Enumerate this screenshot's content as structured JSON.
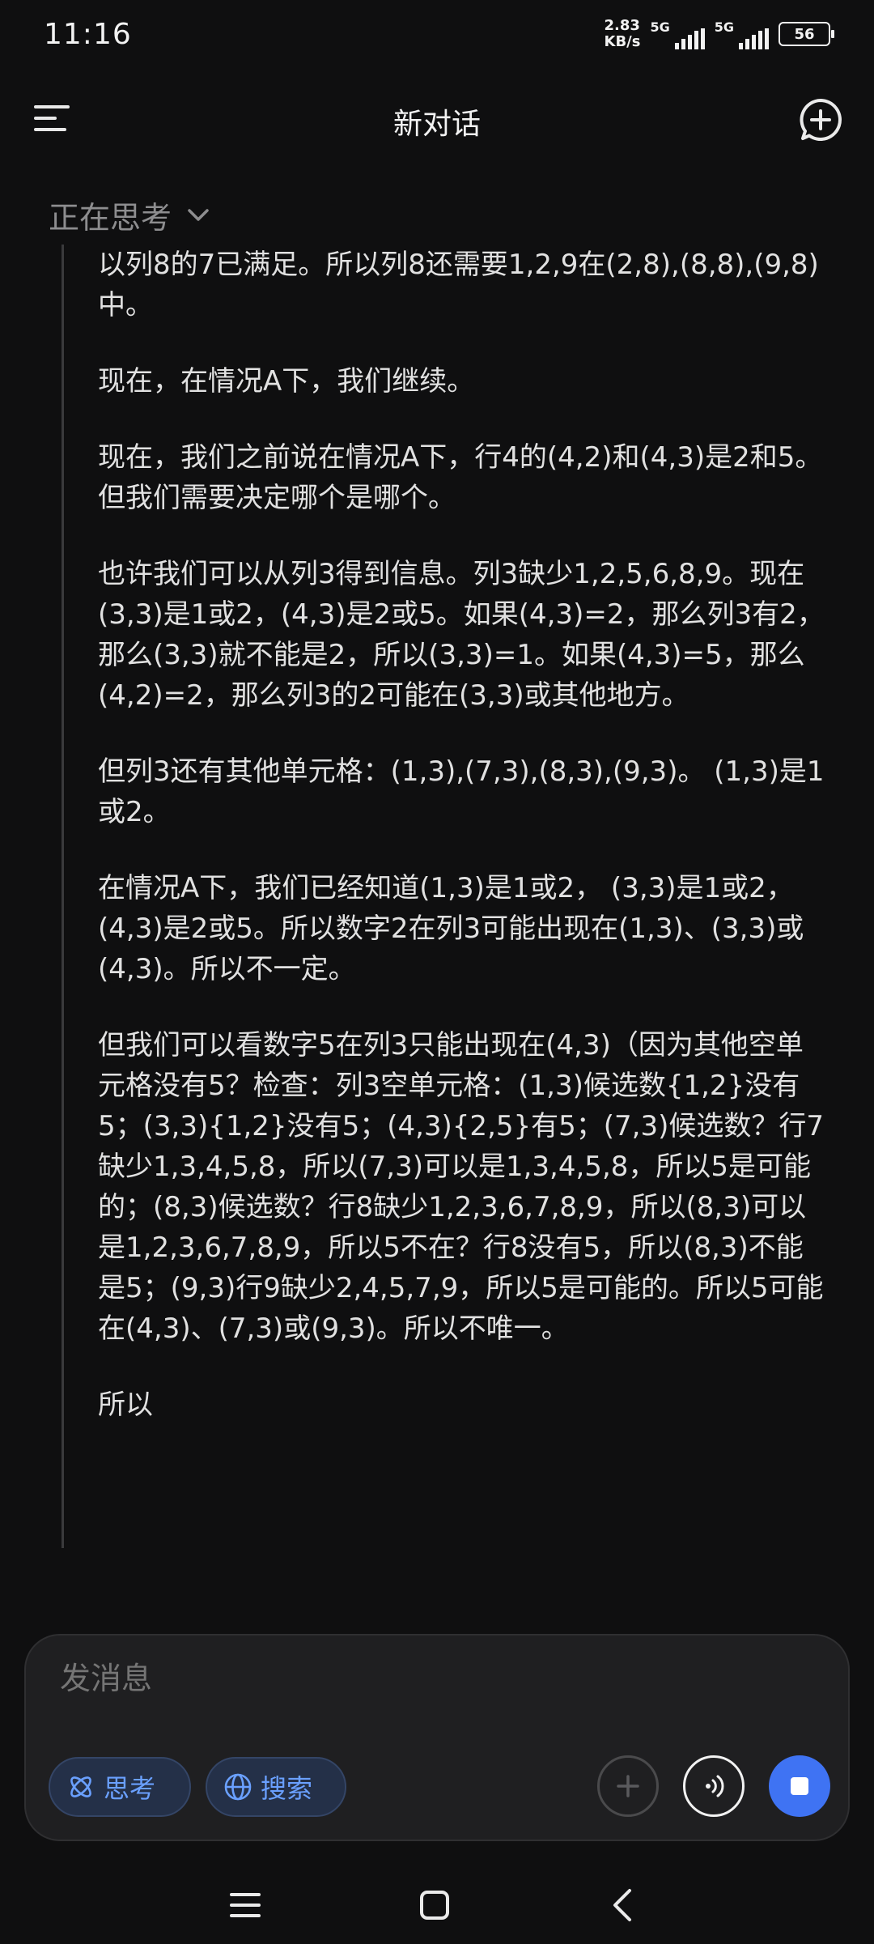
{
  "status_bar": {
    "time": "11:16",
    "speed_value": "2.83",
    "speed_unit": "KB/s",
    "network_1": "5G",
    "network_2": "5G",
    "battery": "56"
  },
  "header": {
    "title": "新对话"
  },
  "thinking": {
    "label": "正在思考",
    "paragraphs": [
      "以列8的7已满足。所以列8还需要1,2,9在(2,8),(8,8),(9,8)中。",
      "现在，在情况A下，我们继续。",
      "现在，我们之前说在情况A下，行4的(4,2)和(4,3)是2和5。但我们需要决定哪个是哪个。",
      "也许我们可以从列3得到信息。列3缺少1,2,5,6,8,9。现在(3,3)是1或2，(4,3)是2或5。如果(4,3)=2，那么列3有2，那么(3,3)就不能是2，所以(3,3)=1。如果(4,3)=5，那么(4,2)=2，那么列3的2可能在(3,3)或其他地方。",
      "但列3还有其他单元格：(1,3),(7,3),(8,3),(9,3)。 (1,3)是1或2。",
      "在情况A下，我们已经知道(1,3)是1或2， (3,3)是1或2，(4,3)是2或5。所以数字2在列3可能出现在(1,3)、(3,3)或(4,3)。所以不一定。",
      "但我们可以看数字5在列3只能出现在(4,3)（因为其他空单元格没有5？检查：列3空单元格：(1,3)候选数{1,2}没有5；(3,3){1,2}没有5；(4,3){2,5}有5；(7,3)候选数？行7缺少1,3,4,5,8，所以(7,3)可以是1,3,4,5,8，所以5是可能的；(8,3)候选数？行8缺少1,2,3,6,7,8,9，所以(8,3)可以是1,2,3,6,7,8,9，所以5不在？行8没有5，所以(8,3)不能是5；(9,3)行9缺少2,4,5,7,9，所以5是可能的。所以5可能在(4,3)、(7,3)或(9,3)。所以不唯一。",
      "所以"
    ]
  },
  "composer": {
    "placeholder": "发消息",
    "think_chip": "思考",
    "search_chip": "搜索"
  }
}
